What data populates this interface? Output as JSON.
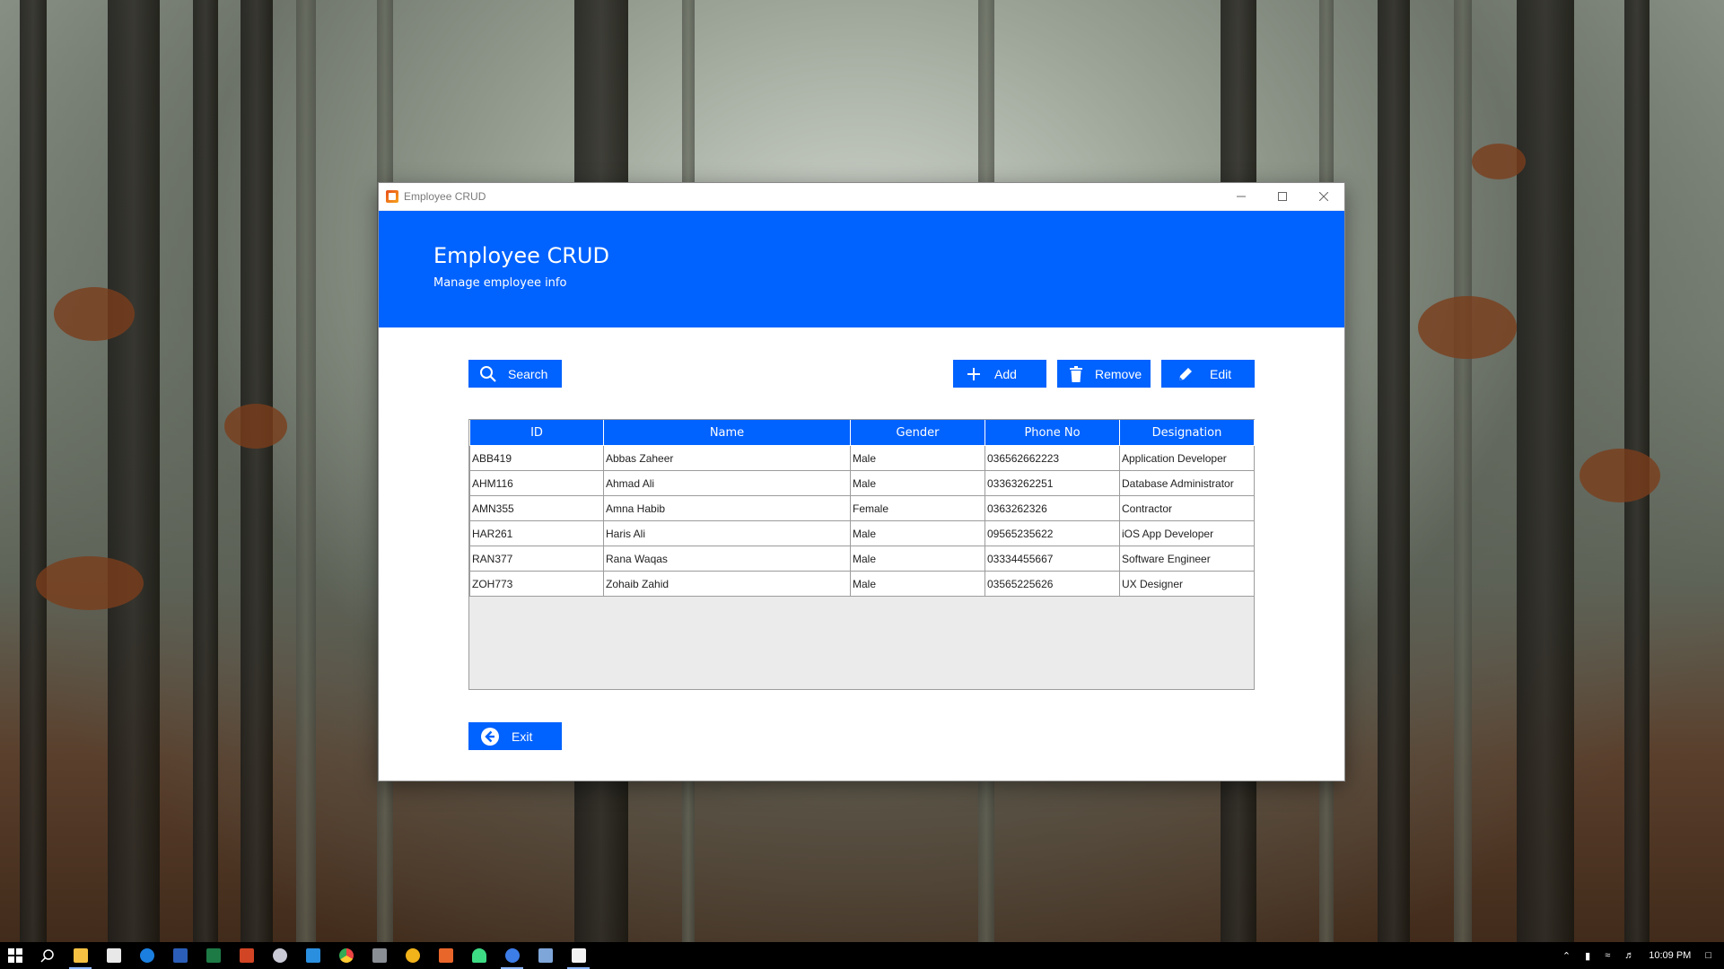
{
  "window": {
    "title": "Employee CRUD",
    "controls": {
      "minimize": "minimize-icon",
      "maximize": "maximize-icon",
      "close": "close-icon"
    }
  },
  "header": {
    "title": "Employee CRUD",
    "subtitle": "Manage employee info",
    "background": "#0062ff"
  },
  "toolbar": {
    "search_label": "Search",
    "add_label": "Add",
    "remove_label": "Remove",
    "edit_label": "Edit",
    "exit_label": "Exit"
  },
  "table": {
    "columns": [
      "ID",
      "Name",
      "Gender",
      "Phone No",
      "Designation"
    ],
    "rows": [
      [
        "ABB419",
        "Abbas Zaheer",
        "Male",
        "036562662223",
        "Application Developer"
      ],
      [
        "AHM116",
        "Ahmad Ali",
        "Male",
        "03363262251",
        "Database Administrator"
      ],
      [
        "AMN355",
        "Amna Habib",
        "Female",
        "0363262326",
        "Contractor"
      ],
      [
        "HAR261",
        "Haris Ali",
        "Male",
        "09565235622",
        "iOS App Developer"
      ],
      [
        "RAN377",
        "Rana Waqas",
        "Male",
        "03334455667",
        "Software Engineer"
      ],
      [
        "ZOH773",
        "Zohaib Zahid",
        "Male",
        "03565225626",
        "UX Designer"
      ]
    ]
  },
  "taskbar": {
    "clock": "10:09 PM",
    "apps": [
      "start-icon",
      "search-icon",
      "file-explorer-icon",
      "store-icon",
      "edge-icon",
      "word-icon",
      "excel-icon",
      "powerpoint-icon",
      "paint-3d-icon",
      "vscode-icon",
      "chrome-icon",
      "app-icon",
      "app-icon",
      "app-icon",
      "android-studio-icon",
      "firefox-icon",
      "virtualbox-icon",
      "java-icon"
    ]
  },
  "colors": {
    "accent": "#0062ff",
    "table_empty": "#ebebeb"
  }
}
